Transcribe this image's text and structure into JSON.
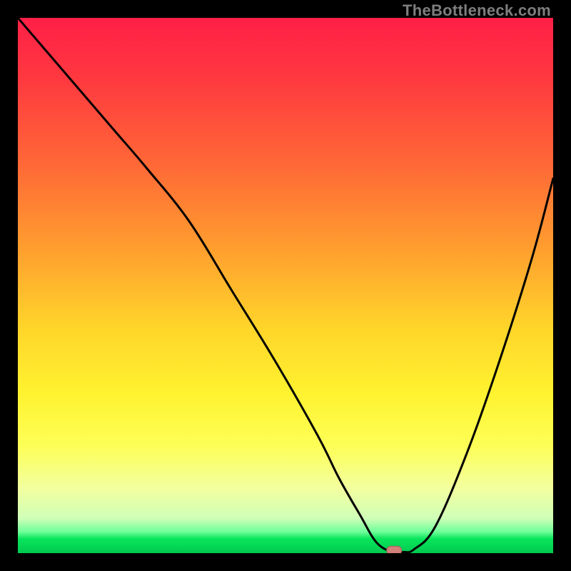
{
  "watermark": {
    "text": "TheBottleneck.com"
  },
  "chart_data": {
    "type": "line",
    "title": "",
    "xlabel": "",
    "ylabel": "",
    "xlim": [
      0,
      100
    ],
    "ylim": [
      0,
      100
    ],
    "grid": false,
    "legend": false,
    "series": [
      {
        "name": "bottleneck-curve",
        "color": "#000000",
        "x": [
          0,
          6,
          12,
          18,
          24,
          32,
          40,
          48,
          56,
          60,
          64,
          67,
          70,
          72,
          74,
          78,
          84,
          90,
          96,
          100
        ],
        "y": [
          100,
          93,
          86,
          79,
          72,
          62,
          49,
          36,
          22,
          14,
          7,
          2,
          0.2,
          0.2,
          0.7,
          5,
          19,
          36,
          55,
          70
        ]
      }
    ],
    "marker": {
      "name": "optimal-point",
      "x": 70.3,
      "y": 0.5,
      "width_pct": 2.8,
      "height_pct": 1.6,
      "fill": "#d1807a",
      "stroke": "#b05a55"
    },
    "background_gradient": {
      "orientation": "vertical",
      "stops": [
        {
          "pos": 0.0,
          "color": "#ff1f47"
        },
        {
          "pos": 0.12,
          "color": "#ff3a3f"
        },
        {
          "pos": 0.28,
          "color": "#ff6a36"
        },
        {
          "pos": 0.42,
          "color": "#ff9a2f"
        },
        {
          "pos": 0.58,
          "color": "#ffd52a"
        },
        {
          "pos": 0.7,
          "color": "#fff22f"
        },
        {
          "pos": 0.8,
          "color": "#fdff57"
        },
        {
          "pos": 0.88,
          "color": "#f2ff9f"
        },
        {
          "pos": 0.935,
          "color": "#d0ffb8"
        },
        {
          "pos": 0.96,
          "color": "#6fff9a"
        },
        {
          "pos": 0.973,
          "color": "#0ae55c"
        },
        {
          "pos": 1.0,
          "color": "#00c94f"
        }
      ]
    }
  }
}
